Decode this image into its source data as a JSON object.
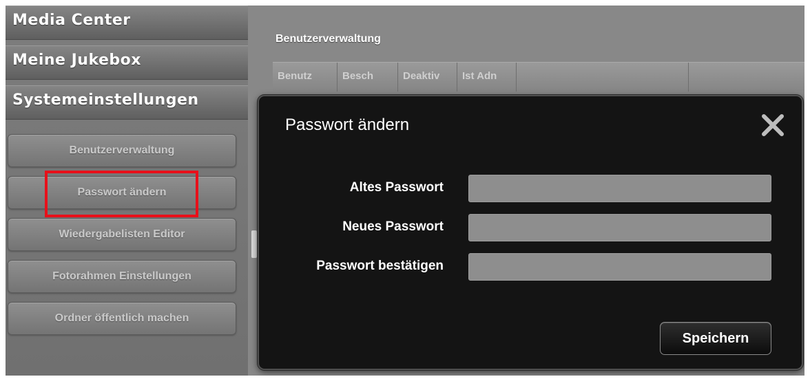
{
  "sidebar": {
    "sections": [
      {
        "label": "Media Center"
      },
      {
        "label": "Meine Jukebox"
      },
      {
        "label": "Systemeinstellungen"
      }
    ],
    "sub_items": [
      {
        "label": "Benutzerverwaltung"
      },
      {
        "label": "Passwort ändern"
      },
      {
        "label": "Wiedergabelisten Editor"
      },
      {
        "label": "Fotorahmen Einstellungen"
      },
      {
        "label": "Ordner öffentlich machen"
      }
    ],
    "highlight_color": "#e8101a"
  },
  "main": {
    "title": "Benutzerverwaltung",
    "columns": [
      {
        "label": "Benutz"
      },
      {
        "label": "Besch"
      },
      {
        "label": "Deaktiv"
      },
      {
        "label": "Ist Adn"
      }
    ]
  },
  "modal": {
    "title": "Passwort ändern",
    "close_icon": "close-icon",
    "fields": [
      {
        "label": "Altes Passwort",
        "value": ""
      },
      {
        "label": "Neues Passwort",
        "value": ""
      },
      {
        "label": "Passwort bestätigen",
        "value": ""
      }
    ],
    "save_label": "Speichern"
  }
}
